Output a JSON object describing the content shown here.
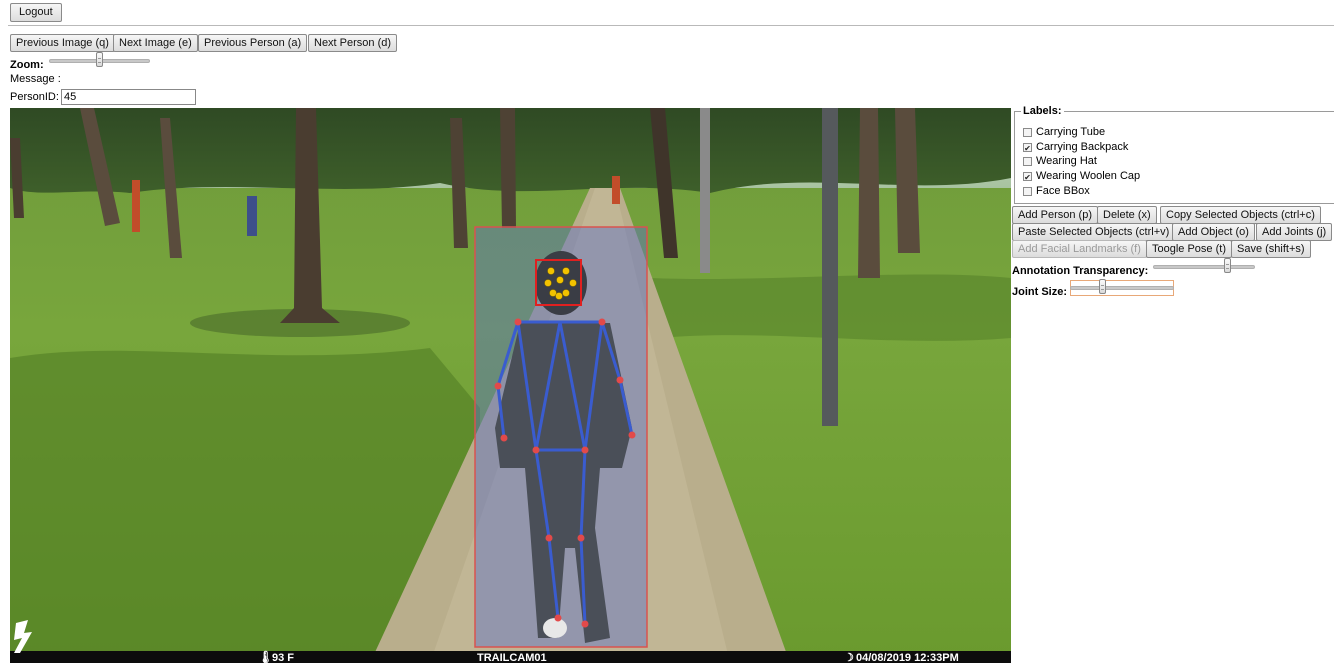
{
  "top": {
    "logout_label": "Logout"
  },
  "nav": {
    "prev_image": "Previous Image (q)",
    "next_image": "Next Image (e)",
    "prev_person": "Previous Person (a)",
    "next_person": "Next Person (d)"
  },
  "zoom": {
    "label": "Zoom:",
    "value": 0.5
  },
  "message": {
    "label": "Message :",
    "text": ""
  },
  "person": {
    "label": "PersonID:",
    "value": "45"
  },
  "labels": {
    "title": "Labels:",
    "items": [
      {
        "label": "Carrying Tube",
        "checked": false
      },
      {
        "label": "Carrying Backpack",
        "checked": true
      },
      {
        "label": "Wearing Hat",
        "checked": false
      },
      {
        "label": "Wearing Woolen Cap",
        "checked": true
      },
      {
        "label": "Face BBox",
        "checked": false
      }
    ]
  },
  "actions": {
    "add_person": "Add Person (p)",
    "delete": "Delete (x)",
    "copy": "Copy Selected Objects (ctrl+c)",
    "paste": "Paste Selected Objects (ctrl+v)",
    "add_object": "Add Object (o)",
    "add_joints": "Add Joints (j)",
    "add_facial": "Add Facial Landmarks (f)",
    "toggle_pose": "Toogle Pose (t)",
    "save": "Save (shift+s)"
  },
  "settings": {
    "transparency_label": "Annotation Transparency:",
    "transparency_value": 0.75,
    "joint_size_label": "Joint Size:",
    "joint_size_value": 0.3
  },
  "camera": {
    "temp": "93 F",
    "name": "TRAILCAM01",
    "datetime": "04/08/2019  12:33PM"
  },
  "colors": {
    "bbox": "#d9534f",
    "bbox_fill": "rgba(90,110,200,0.45)",
    "skeleton": "#3a5ccf",
    "joint": "#e24a4a",
    "face_box": "#e02020",
    "face_point": "#f2c200"
  }
}
